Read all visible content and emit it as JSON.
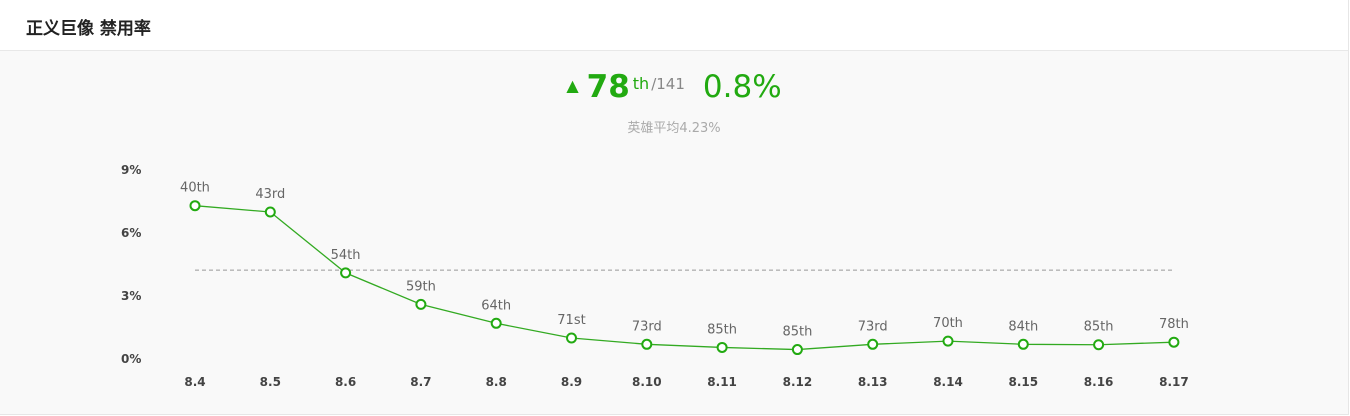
{
  "header": {
    "title": "正义巨像 禁用率"
  },
  "summary": {
    "arrow": "▲",
    "rank": "78",
    "rank_suffix": "th",
    "rank_total": "/141",
    "rate": "0.8%",
    "average_label": "英雄平均4.23%"
  },
  "colors": {
    "accent": "#22aa11",
    "line": "#33aa22",
    "average_line": "#999999",
    "background": "#f9f9f9"
  },
  "chart_data": {
    "type": "line",
    "categories": [
      "8.4",
      "8.5",
      "8.6",
      "8.7",
      "8.8",
      "8.9",
      "8.10",
      "8.11",
      "8.12",
      "8.13",
      "8.14",
      "8.15",
      "8.16",
      "8.17"
    ],
    "series": [
      {
        "values": [
          7.3,
          7.0,
          4.1,
          2.6,
          1.7,
          1.0,
          0.7,
          0.55,
          0.45,
          0.7,
          0.85,
          0.7,
          0.68,
          0.8
        ],
        "point_labels": [
          "40th",
          "43rd",
          "54th",
          "59th",
          "64th",
          "71st",
          "73rd",
          "85th",
          "85th",
          "73rd",
          "70th",
          "84th",
          "85th",
          "78th"
        ]
      }
    ],
    "average": 4.23,
    "y_ticks": [
      "0%",
      "3%",
      "6%",
      "9%"
    ],
    "y_tick_values": [
      0,
      3,
      6,
      9
    ],
    "ylim": [
      0,
      9
    ],
    "grid": false,
    "legend": "none"
  }
}
